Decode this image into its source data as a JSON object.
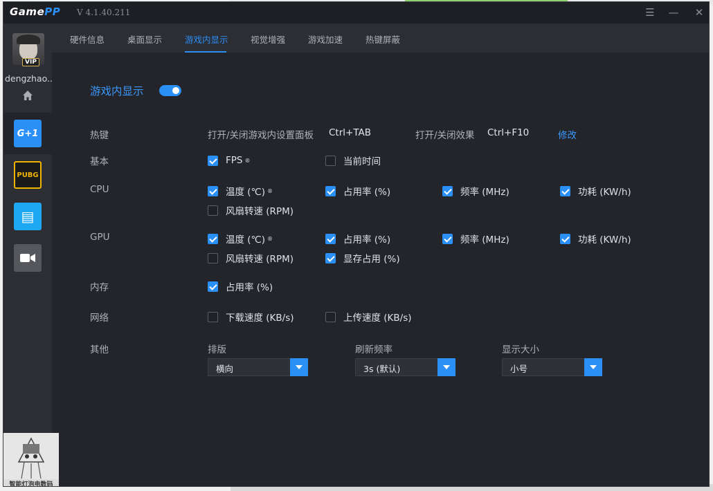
{
  "app": {
    "logo_game": "Game",
    "logo_pp": "PP",
    "version": "V 4.1.40.211"
  },
  "window_controls": {
    "menu": "☰",
    "minimize": "—",
    "close": "✕"
  },
  "sidebar": {
    "username": "dengzhao...",
    "vip_badge": "VIP",
    "items": [
      {
        "name": "gamepp-overlay",
        "glyph": "G+1",
        "color": "#2a8ff7"
      },
      {
        "name": "pubg",
        "glyph": "PUBG",
        "color": "#f0b400"
      },
      {
        "name": "notes",
        "glyph": "▤",
        "color": "#1ea7f2"
      },
      {
        "name": "video",
        "glyph": "■",
        "color": "#55575c"
      }
    ],
    "qr_caption": "智能灯泡电数码"
  },
  "tabs": [
    {
      "label": "硬件信息",
      "active": false
    },
    {
      "label": "桌面显示",
      "active": false
    },
    {
      "label": "游戏内显示",
      "active": true
    },
    {
      "label": "视觉增强",
      "active": false
    },
    {
      "label": "游戏加速",
      "active": false
    },
    {
      "label": "热键屏蔽",
      "active": false
    }
  ],
  "main": {
    "title": "游戏内显示",
    "enabled": true,
    "hotkeys": {
      "label": "热键",
      "panel_label": "打开/关闭游戏内设置面板",
      "panel_key": "Ctrl+TAB",
      "effect_label": "打开/关闭效果",
      "effect_key": "Ctrl+F10",
      "modify": "修改"
    },
    "basic": {
      "label": "基本",
      "fps": {
        "label": "FPS",
        "mark": "®",
        "checked": true
      },
      "time": {
        "label": "当前时间",
        "checked": false
      }
    },
    "cpu": {
      "label": "CPU",
      "temp": {
        "label": "温度 (℃)",
        "mark": "®",
        "checked": true
      },
      "usage": {
        "label": "占用率 (%)",
        "checked": true
      },
      "freq": {
        "label": "频率 (MHz)",
        "checked": true
      },
      "power": {
        "label": "功耗 (KW/h)",
        "checked": true
      },
      "fan": {
        "label": "风扇转速 (RPM)",
        "checked": false
      }
    },
    "gpu": {
      "label": "GPU",
      "temp": {
        "label": "温度 (℃)",
        "mark": "®",
        "checked": true
      },
      "usage": {
        "label": "占用率 (%)",
        "checked": true
      },
      "freq": {
        "label": "频率 (MHz)",
        "checked": true
      },
      "power": {
        "label": "功耗 (KW/h)",
        "checked": true
      },
      "fan": {
        "label": "风扇转速 (RPM)",
        "checked": false
      },
      "vram": {
        "label": "显存占用 (%)",
        "checked": true
      }
    },
    "memory": {
      "label": "内存",
      "usage": {
        "label": "占用率 (%)",
        "checked": true
      }
    },
    "network": {
      "label": "网络",
      "down": {
        "label": "下载速度 (KB/s)",
        "checked": false
      },
      "up": {
        "label": "上传速度 (KB/s)",
        "checked": false
      }
    },
    "other": {
      "label": "其他",
      "layout": {
        "label": "排版",
        "value": "横向"
      },
      "refresh": {
        "label": "刷新频率",
        "value": "3s (默认)"
      },
      "size": {
        "label": "显示大小",
        "value": "小号"
      }
    }
  }
}
